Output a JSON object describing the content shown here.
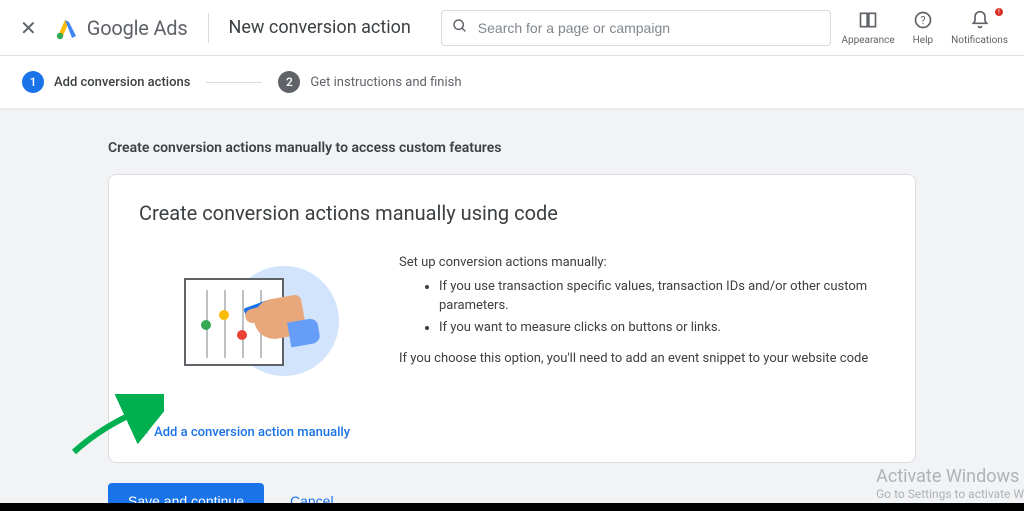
{
  "header": {
    "brand": "Google Ads",
    "page_title": "New conversion action",
    "search_placeholder": "Search for a page or campaign",
    "icons": {
      "appearance": "Appearance",
      "help": "Help",
      "notifications": "Notifications"
    }
  },
  "stepper": {
    "step1": {
      "num": "1",
      "label": "Add conversion actions"
    },
    "step2": {
      "num": "2",
      "label": "Get instructions and finish"
    }
  },
  "section_heading": "Create conversion actions manually to access custom features",
  "card": {
    "title": "Create conversion actions manually using code",
    "intro": "Set up conversion actions manually:",
    "bullets": [
      "If you use transaction specific values, transaction IDs and/or other custom parameters.",
      "If you want to measure clicks on buttons or links."
    ],
    "note": "If you choose this option, you'll need to add an event snippet to your website code",
    "add_link": "Add a conversion action manually"
  },
  "footer": {
    "save": "Save and continue",
    "cancel": "Cancel"
  },
  "watermark": {
    "line1": "Activate Windows",
    "line2": "Go to Settings to activate W"
  }
}
